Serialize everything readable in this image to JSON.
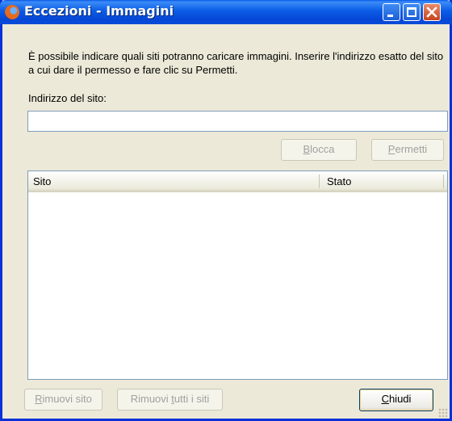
{
  "window": {
    "title": "Eccezioni - Immagini",
    "icon": "firefox-icon",
    "controls": [
      "minimize-icon",
      "maximize-icon",
      "close-icon"
    ]
  },
  "description": "È possibile indicare quali siti potranno caricare immagini. Inserire l'indirizzo esatto del sito a cui dare il permesso e fare clic su Permetti.",
  "site_field": {
    "label": "Indirizzo del sito:",
    "value": "",
    "placeholder": ""
  },
  "actions": {
    "blocca": {
      "prefix": "",
      "accel": "B",
      "suffix": "locca",
      "enabled": false
    },
    "permetti": {
      "prefix": "",
      "accel": "P",
      "suffix": "ermetti",
      "enabled": false
    }
  },
  "list": {
    "columns": [
      "Sito",
      "Stato"
    ],
    "rows": []
  },
  "footer": {
    "rimuovi": {
      "prefix": "",
      "accel": "R",
      "suffix": "imuovi sito",
      "enabled": false
    },
    "rimuovi_tutti": {
      "prefix": "Rimuovi ",
      "accel": "t",
      "suffix": "utti i siti",
      "enabled": false
    },
    "chiudi": {
      "prefix": "",
      "accel": "C",
      "suffix": "hiudi",
      "enabled": true
    }
  },
  "colors": {
    "titlebar": "#0a5ae8",
    "window_bg": "#ece9d8",
    "border": "#0831d9"
  }
}
